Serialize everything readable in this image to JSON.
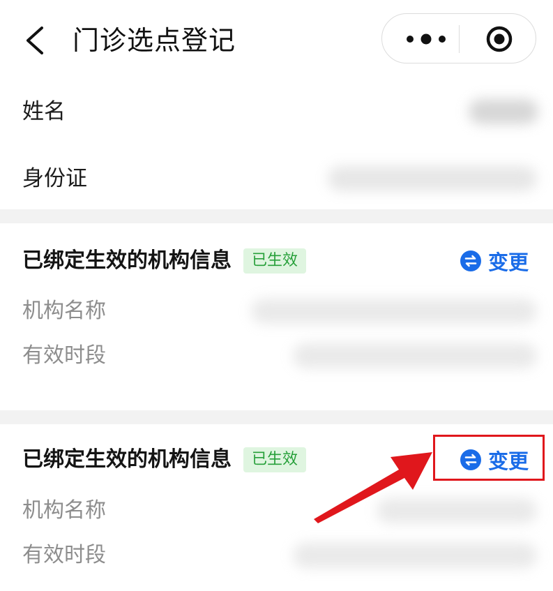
{
  "nav": {
    "title": "门诊选点登记"
  },
  "profile": {
    "name_label": "姓名",
    "id_label": "身份证"
  },
  "cards": [
    {
      "title": "已绑定生效的机构信息",
      "badge": "已生效",
      "change_label": "变更",
      "fields": [
        "机构名称",
        "有效时段"
      ]
    },
    {
      "title": "已绑定生效的机构信息",
      "badge": "已生效",
      "change_label": "变更",
      "fields": [
        "机构名称",
        "有效时段"
      ]
    }
  ],
  "colors": {
    "accent": "#1a6ce8",
    "badge_bg": "#dff5e0",
    "badge_text": "#27a03a",
    "annotation": "#e0171c"
  },
  "icons": [
    "back-icon",
    "more-icon",
    "target-icon",
    "swap-icon",
    "arrow-annotation-icon"
  ]
}
